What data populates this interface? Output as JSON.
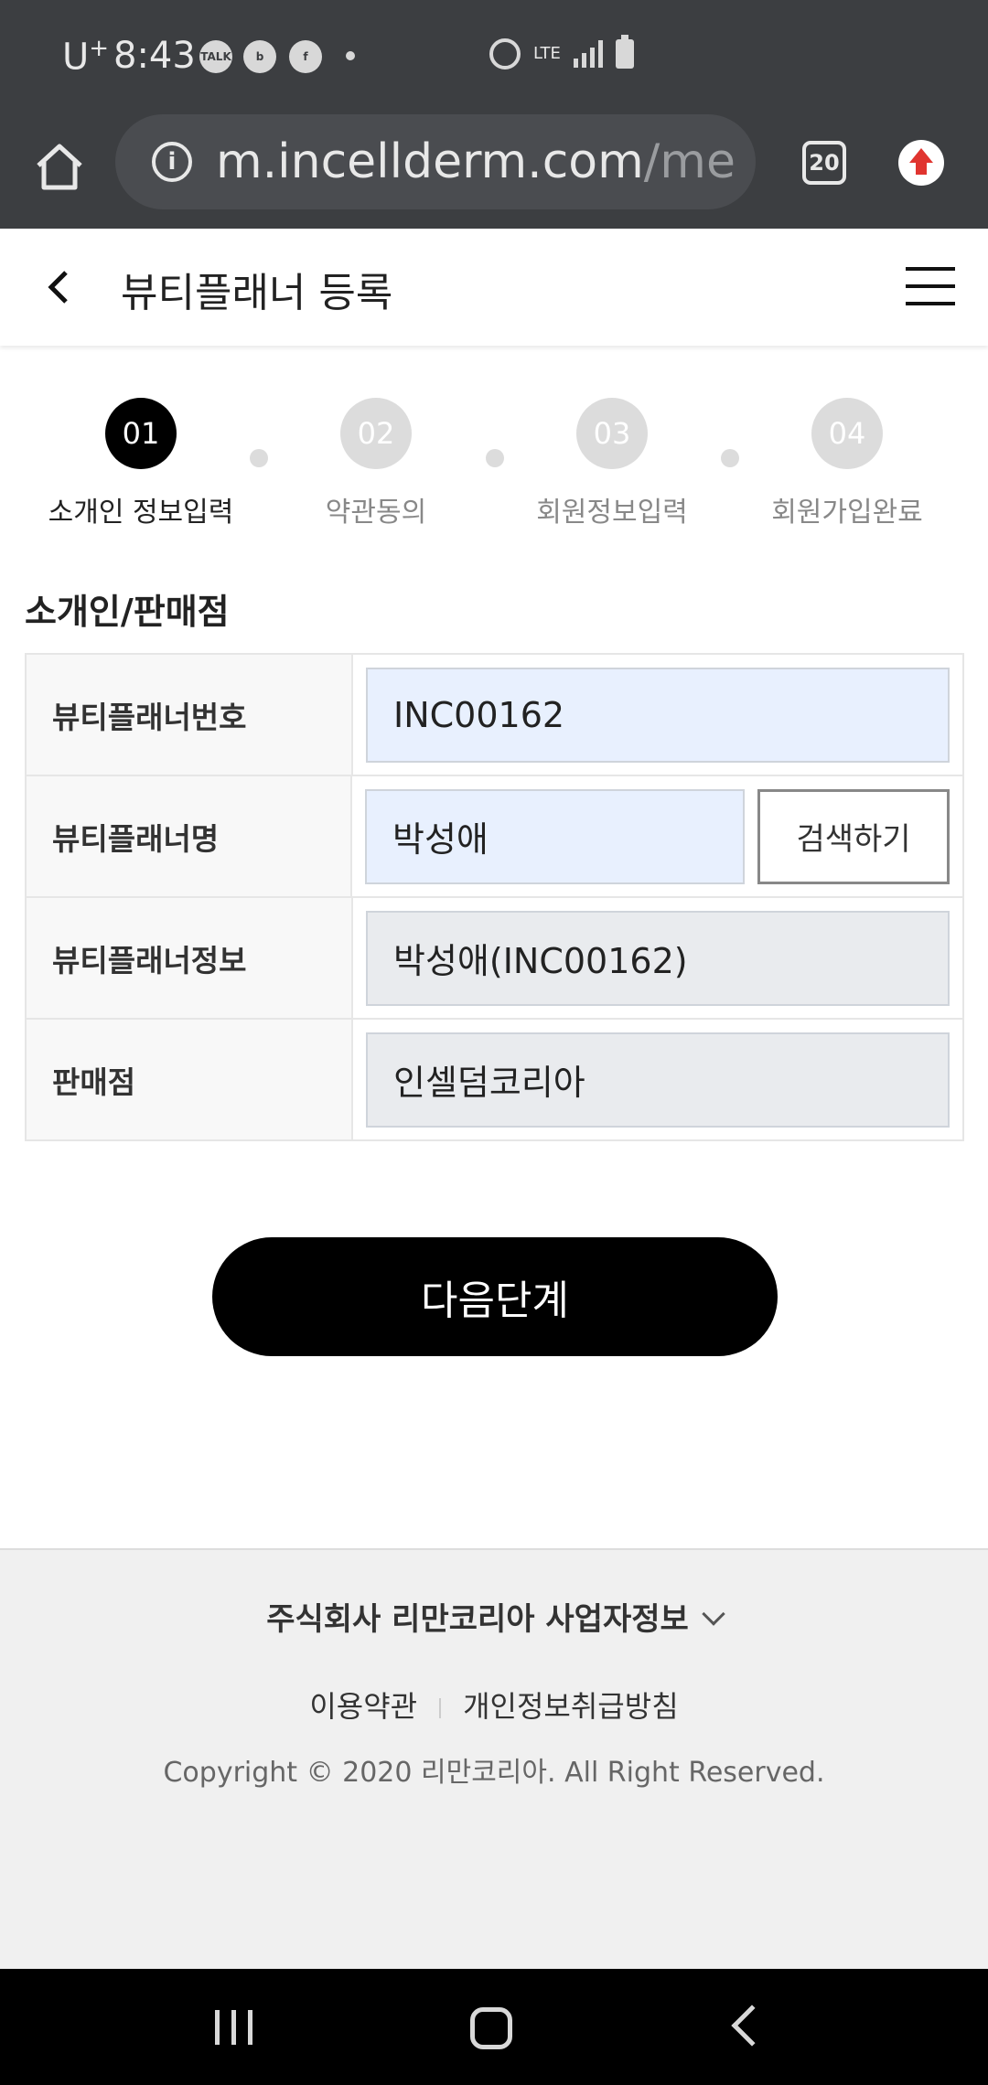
{
  "status_bar": {
    "carrier": "U",
    "carrier_sup": "+",
    "time": "8:43",
    "apps": [
      "talk-icon",
      "b-app-icon",
      "facebook-icon"
    ],
    "app_talk_label": "TALK",
    "app_b_label": "b",
    "app_fb_label": "f",
    "network": "LTE"
  },
  "browser": {
    "url_main": "m.incellderm.com",
    "url_rest": "/men",
    "tab_count": "20"
  },
  "header": {
    "title": "뷰티플래너 등록"
  },
  "steps": [
    {
      "number": "01",
      "label": "소개인 정보입력",
      "active": true
    },
    {
      "number": "02",
      "label": "약관동의",
      "active": false
    },
    {
      "number": "03",
      "label": "회원정보입력",
      "active": false
    },
    {
      "number": "04",
      "label": "회원가입완료",
      "active": false
    }
  ],
  "section": {
    "title": "소개인/판매점"
  },
  "form": {
    "planner_number_label": "뷰티플래너번호",
    "planner_number_value": "INC00162",
    "planner_name_label": "뷰티플래너명",
    "planner_name_value": "박성애",
    "search_button": "검색하기",
    "planner_info_label": "뷰티플래너정보",
    "planner_info_value": "박성애(INC00162)",
    "store_label": "판매점",
    "store_value": "인셀덤코리아"
  },
  "next_button": "다음단계",
  "footer": {
    "company_info": "주식회사 리만코리아 사업자정보",
    "terms_link": "이용약관",
    "privacy_link": "개인정보취급방침",
    "copyright": "Copyright © 2020 리만코리아. All Right Reserved."
  },
  "colors": {
    "status_bg": "#3c3e41",
    "editable_field": "#e8f0fe",
    "readonly_field": "#e9ebee",
    "primary_button": "#000000",
    "step_inactive": "#dcdcdc"
  }
}
